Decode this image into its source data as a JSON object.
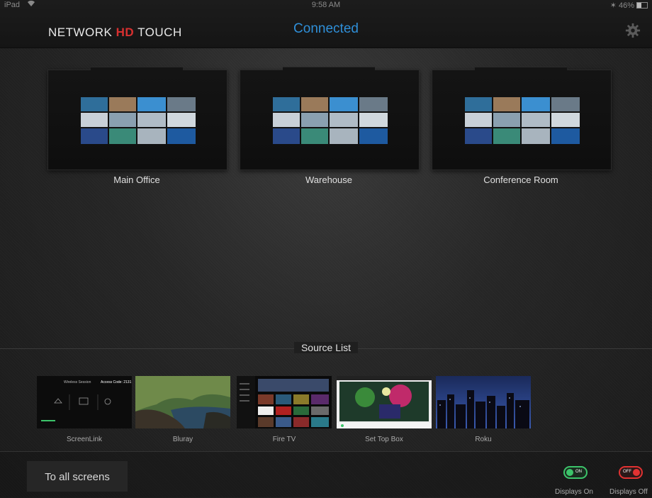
{
  "status_bar": {
    "carrier": "iPad",
    "time": "9:58 AM",
    "battery": "46%"
  },
  "header": {
    "logo_text_1": "NETWORK",
    "logo_hd": "HD",
    "logo_text_2": "TOUCH",
    "connection_status": "Connected"
  },
  "zones": [
    {
      "label": "Main Office"
    },
    {
      "label": "Warehouse"
    },
    {
      "label": "Conference Room"
    }
  ],
  "source_list": {
    "title": "Source List",
    "sources": [
      {
        "name": "ScreenLink",
        "thumb_title": "Wireless Session",
        "thumb_code": "Access Code: 2131"
      },
      {
        "name": "Bluray"
      },
      {
        "name": "Fire TV"
      },
      {
        "name": "Set Top Box"
      },
      {
        "name": "Roku"
      }
    ]
  },
  "bottom_bar": {
    "to_all_screens_label": "To all screens",
    "displays_on": {
      "toggle_text": "ON",
      "label": "Displays On"
    },
    "displays_off": {
      "toggle_text": "OFF",
      "label": "Displays Off"
    }
  },
  "colors": {
    "accent_blue": "#2f8fd8",
    "on_green": "#3cc46a",
    "off_red": "#e23232",
    "hd_red": "#d83030"
  }
}
